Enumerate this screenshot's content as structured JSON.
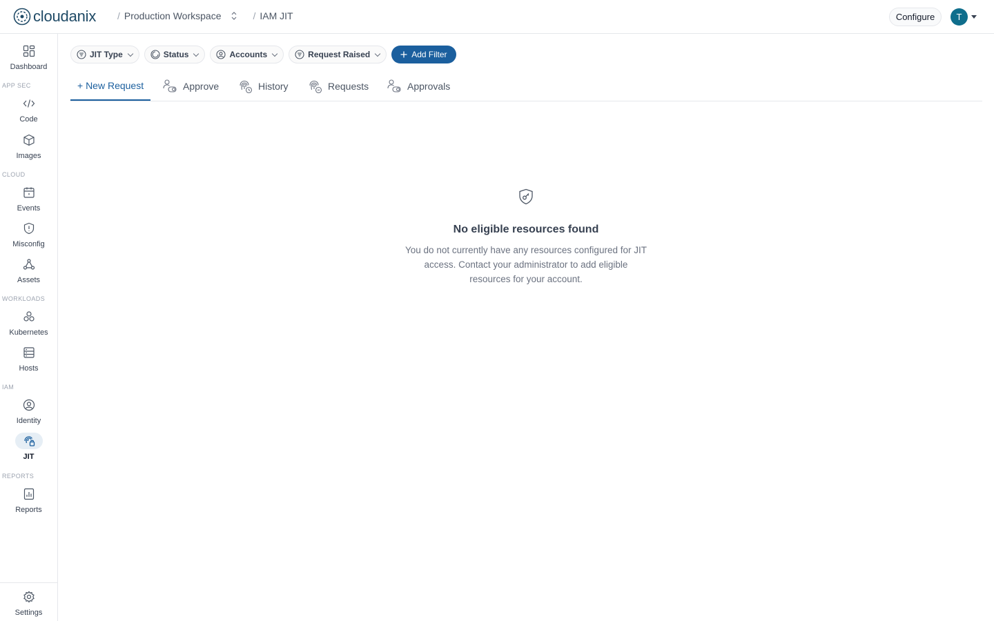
{
  "app": {
    "logo_text": "cloudanix"
  },
  "breadcrumb": {
    "workspace": "Production Workspace",
    "page": "IAM JIT",
    "separator": "/"
  },
  "header": {
    "configure_label": "Configure",
    "avatar_initial": "T"
  },
  "sidebar": {
    "top": {
      "label": "Dashboard",
      "icon": "dashboard-icon"
    },
    "sections": [
      {
        "title": "APP SEC",
        "items": [
          {
            "label": "Code",
            "icon": "code-icon"
          },
          {
            "label": "Images",
            "icon": "cube-icon"
          }
        ]
      },
      {
        "title": "CLOUD",
        "items": [
          {
            "label": "Events",
            "icon": "calendar-icon"
          },
          {
            "label": "Misconfig",
            "icon": "shield-alert-icon"
          },
          {
            "label": "Assets",
            "icon": "graph-icon"
          }
        ]
      },
      {
        "title": "WORKLOADS",
        "items": [
          {
            "label": "Kubernetes",
            "icon": "kubernetes-icon"
          },
          {
            "label": "Hosts",
            "icon": "server-icon"
          }
        ]
      },
      {
        "title": "IAM",
        "items": [
          {
            "label": "Identity",
            "icon": "identity-icon"
          },
          {
            "label": "JIT",
            "icon": "jit-icon",
            "active": true
          }
        ]
      },
      {
        "title": "REPORTS",
        "items": [
          {
            "label": "Reports",
            "icon": "report-icon"
          }
        ]
      }
    ],
    "bottom": {
      "label": "Settings",
      "icon": "gear-icon"
    }
  },
  "filters": {
    "chips": [
      {
        "label": "JIT Type",
        "icon": "filter-list-icon"
      },
      {
        "label": "Status",
        "icon": "status-icon"
      },
      {
        "label": "Accounts",
        "icon": "user-circle-icon"
      },
      {
        "label": "Request Raised",
        "icon": "filter-list-icon"
      }
    ],
    "add_filter_label": "Add Filter"
  },
  "tabs": [
    {
      "label": "+ New Request",
      "active": true
    },
    {
      "label": "Approve",
      "icon": "approve-icon"
    },
    {
      "label": "History",
      "icon": "fingerprint-icon"
    },
    {
      "label": "Requests",
      "icon": "fingerprint-icon"
    },
    {
      "label": "Approvals",
      "icon": "approve-icon"
    }
  ],
  "empty_state": {
    "title": "No eligible resources found",
    "description": "You do not currently have any resources configured for JIT access. Contact your administrator to add eligible resources for your account."
  },
  "colors": {
    "primary": "#1b5f9e",
    "avatar": "#0f6e8c",
    "logo": "#1f4a66",
    "active_nav_bg": "#e6eef5"
  }
}
